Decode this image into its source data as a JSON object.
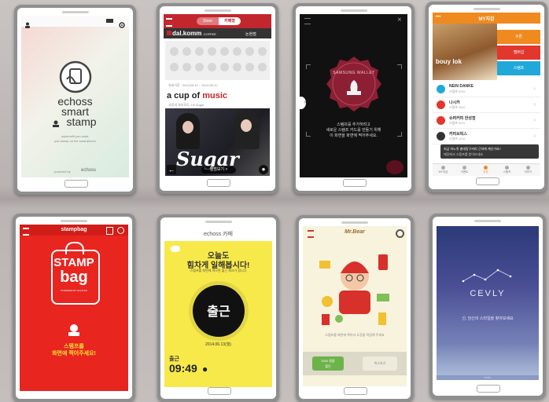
{
  "p1": {
    "brand_line1": "echoss",
    "brand_line2": "smart",
    "brand_line3": "stamp",
    "tag1": "mybenefit you want,",
    "tag2": "just stamp on the smartphone",
    "footer": "powered by",
    "footer_brand": "echoss"
  },
  "p2": {
    "tab_store": "Store",
    "tab_cafe": "카페형",
    "brand": "dal.komm",
    "brand_sub": "COFFEE",
    "side": "논현점",
    "date": "유효기간 : 2014.09.11 ~ 2014.09.11",
    "title_a": "a cup of",
    "title_b": "music",
    "subtitle": "사랑의 자리모도 J B Sugar",
    "poster": "Sugar",
    "more": "앨범보기 >"
  },
  "p3": {
    "wallet": "SAMSUNG WALLET",
    "msg1": "스탬프를 추가하려고",
    "msg2": "새로운 스탬프 카드를 만들기 위해",
    "msg3": "이 화면을 화면에 찍어주세요."
  },
  "p4": {
    "title": "MY지갑",
    "btn1": "쿠폰",
    "btn2": "멤버십",
    "btn3": "스탬프",
    "card_text": "bouy lok",
    "items": [
      {
        "name": "NEIN DANKE",
        "sub": "스탬프 0/10"
      },
      {
        "name": "나시카",
        "sub": "스탬프 3/10"
      },
      {
        "name": "슈퍼커피 한성점",
        "sub": "스탬프 5/10"
      },
      {
        "name": "커피브릭스",
        "sub": "스탬프 1/10"
      }
    ],
    "tooltip1": "지금 하노쥬 총대망구커피 근처에 계신가요?",
    "tooltip2": "매장에서 스탬프를 받아보세요",
    "nav": [
      "MY지갑",
      "이벤트",
      "쿠폰",
      "스탬프",
      "더보기"
    ]
  },
  "p5": {
    "brand": "stampbag",
    "logo1": "STAMP",
    "logo2": "bag",
    "powered": "POWERED BY ECHOSS",
    "msg1": "스탬프를",
    "msg2": "화면에 찍어주세요!"
  },
  "p6": {
    "brand": "echoss 카페",
    "head1": "오늘도",
    "head2": "힘차게 일해봅시다!",
    "head3": "스탬프를 화면에 찍으면 출근 체크가 됩니다",
    "stamp": "출근",
    "date": "2014.06.13(월)",
    "label": "출근",
    "time": "09:49"
  },
  "p7": {
    "logo": "Mr.Bear",
    "info": "스탬프를 화면에 찍어서 도장을 적립해 주세요",
    "btn1": "2000 원을",
    "btn1b": "할인",
    "btn2": "취소하기"
  },
  "p8": {
    "logo": "CEVLY",
    "msg": "신, 당신의 스타일을 찾아보세요",
    "sub": "enter"
  }
}
